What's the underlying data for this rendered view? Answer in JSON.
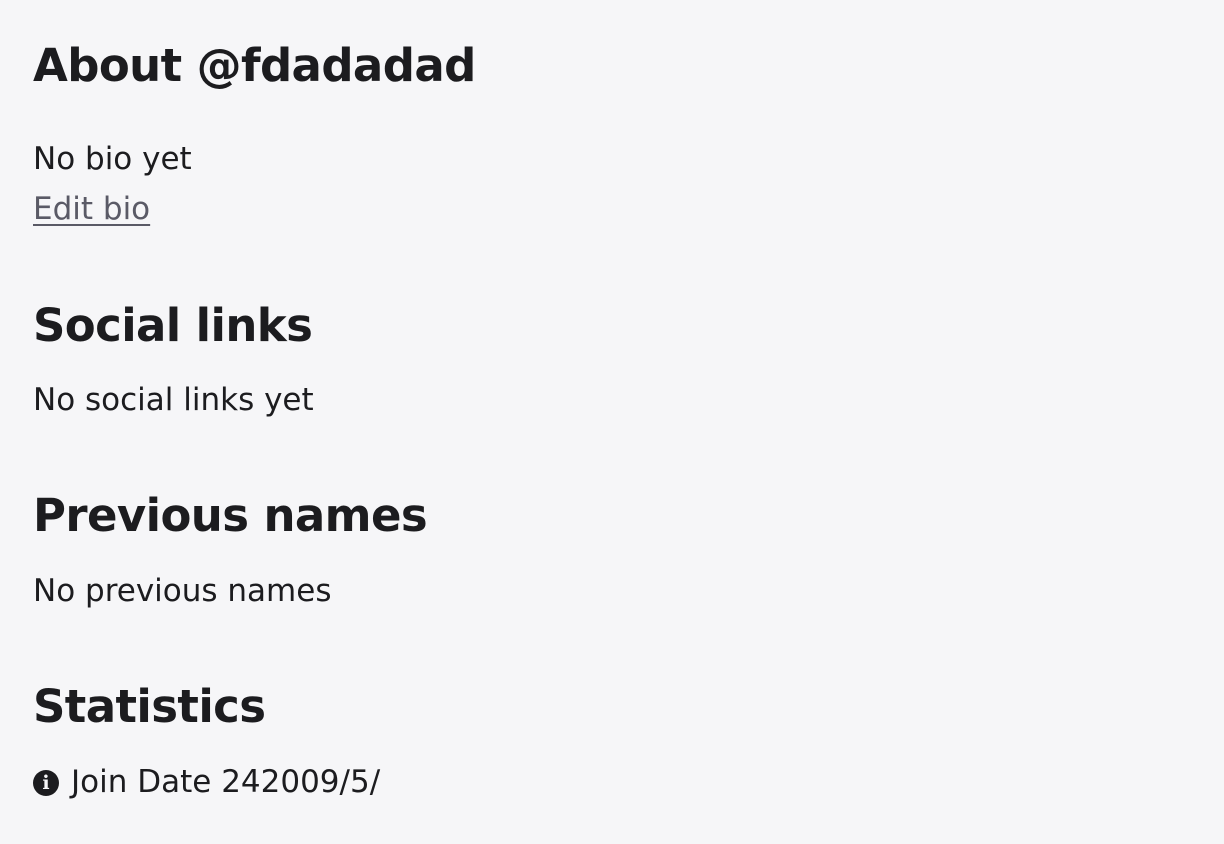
{
  "about": {
    "heading": "About @fdadadad",
    "bio_text": "No bio yet",
    "edit_bio_label": "Edit bio"
  },
  "social_links": {
    "heading": "Social links",
    "empty_text": "No social links yet"
  },
  "previous_names": {
    "heading": "Previous names",
    "empty_text": "No previous names"
  },
  "statistics": {
    "heading": "Statistics",
    "join_date_label": "Join Date",
    "join_date_value": "242009/5/",
    "icon": "info-icon"
  },
  "colors": {
    "background": "#f6f6f8",
    "text": "#1c1c1f",
    "link": "#5a5a66"
  }
}
